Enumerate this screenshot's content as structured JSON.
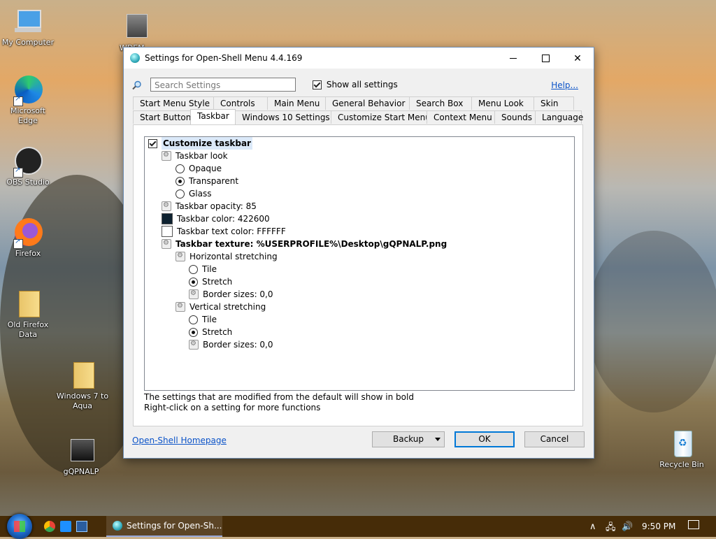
{
  "desktop": {
    "icons": [
      {
        "label": "My Computer"
      },
      {
        "label": "WDEM..."
      },
      {
        "label": "Microsoft Edge"
      },
      {
        "label": "OBS Studio"
      },
      {
        "label": "Firefox"
      },
      {
        "label": "Old Firefox Data"
      },
      {
        "label": "Windows 7 to Aqua"
      },
      {
        "label": "gQPNALP"
      },
      {
        "label": "Recycle Bin"
      }
    ]
  },
  "window": {
    "title": "Settings for Open-Shell Menu 4.4.169",
    "search_placeholder": "Search Settings",
    "show_all_label": "Show all settings",
    "help_label": "Help...",
    "tabs_row1": [
      "Start Menu Style",
      "Controls",
      "Main Menu",
      "General Behavior",
      "Search Box",
      "Menu Look",
      "Skin"
    ],
    "tabs_row2": [
      "Start Button",
      "Taskbar",
      "Windows 10 Settings",
      "Customize Start Menu",
      "Context Menu",
      "Sounds",
      "Language"
    ],
    "selected_tab": "Taskbar",
    "tree": [
      {
        "text": "Customize taskbar",
        "kind": "checkbox",
        "checked": true,
        "bold": true
      },
      {
        "text": "Taskbar look",
        "kind": "gear"
      },
      {
        "text": "Opaque",
        "kind": "radio",
        "checked": false
      },
      {
        "text": "Transparent",
        "kind": "radio",
        "checked": true
      },
      {
        "text": "Glass",
        "kind": "radio",
        "checked": false
      },
      {
        "text": "Taskbar opacity: 85",
        "kind": "gear"
      },
      {
        "text": "Taskbar color: 422600",
        "kind": "swatch",
        "color": "#0e2230"
      },
      {
        "text": "Taskbar text color: FFFFFF",
        "kind": "swatch",
        "color": "#ffffff"
      },
      {
        "text": "Taskbar texture: %USERPROFILE%\\Desktop\\gQPNALP.png",
        "kind": "gear",
        "bold": true
      },
      {
        "text": "Horizontal stretching",
        "kind": "gear"
      },
      {
        "text": "Tile",
        "kind": "radio",
        "checked": false
      },
      {
        "text": "Stretch",
        "kind": "radio",
        "checked": true
      },
      {
        "text": "Border sizes: 0,0",
        "kind": "gear"
      },
      {
        "text": "Vertical stretching",
        "kind": "gear"
      },
      {
        "text": "Tile",
        "kind": "radio",
        "checked": false
      },
      {
        "text": "Stretch",
        "kind": "radio",
        "checked": true
      },
      {
        "text": "Border sizes: 0,0",
        "kind": "gear"
      }
    ],
    "note1": "The settings that are modified from the default will show in bold",
    "note2": "Right-click on a setting for more functions",
    "homepage_link": "Open-Shell Homepage",
    "backup_label": "Backup",
    "ok_label": "OK",
    "cancel_label": "Cancel"
  },
  "taskbar": {
    "task_label": "Settings for Open-Sh...",
    "clock": "9:50 PM",
    "background": "#422600"
  }
}
